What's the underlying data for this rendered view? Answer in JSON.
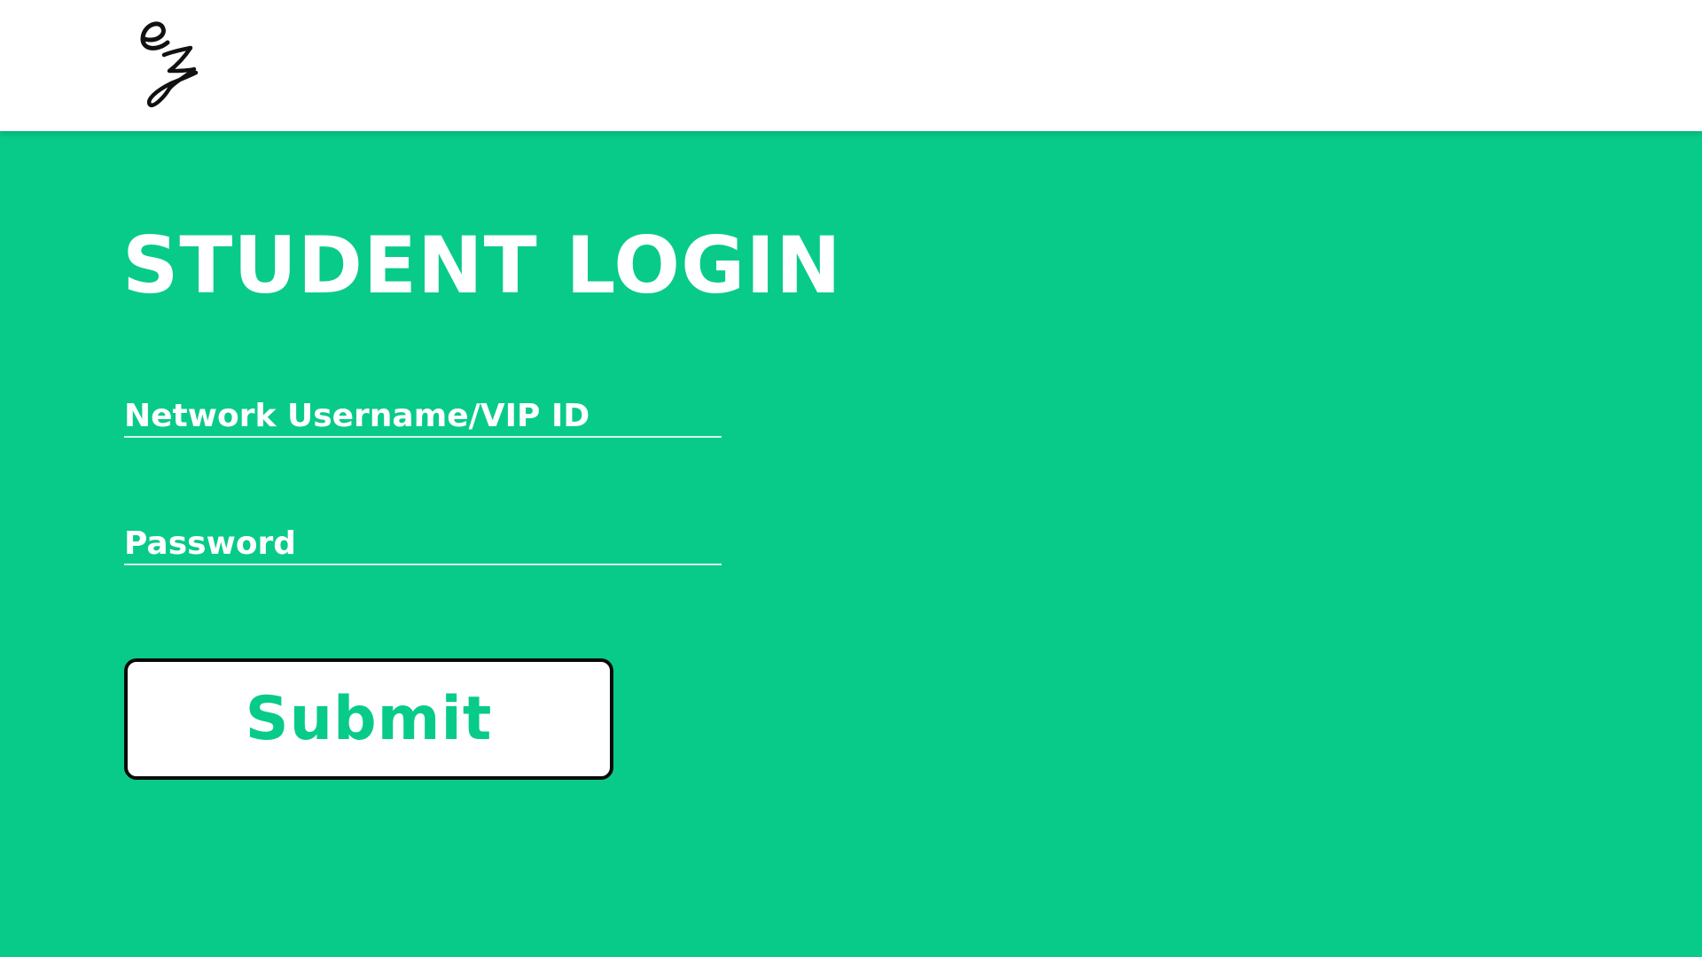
{
  "header": {
    "logo_icon": "ez-monogram-logo",
    "logo_text": "ez"
  },
  "login": {
    "title": "STUDENT LOGIN",
    "username_placeholder": "Network Username/VIP ID",
    "username_value": "",
    "password_placeholder": "Password",
    "password_value": "",
    "submit_label": "Submit"
  },
  "colors": {
    "brand_green": "#08cb8a",
    "header_bg": "#ffffff",
    "text_light": "#ffffff",
    "button_border": "#0a0a0a"
  }
}
